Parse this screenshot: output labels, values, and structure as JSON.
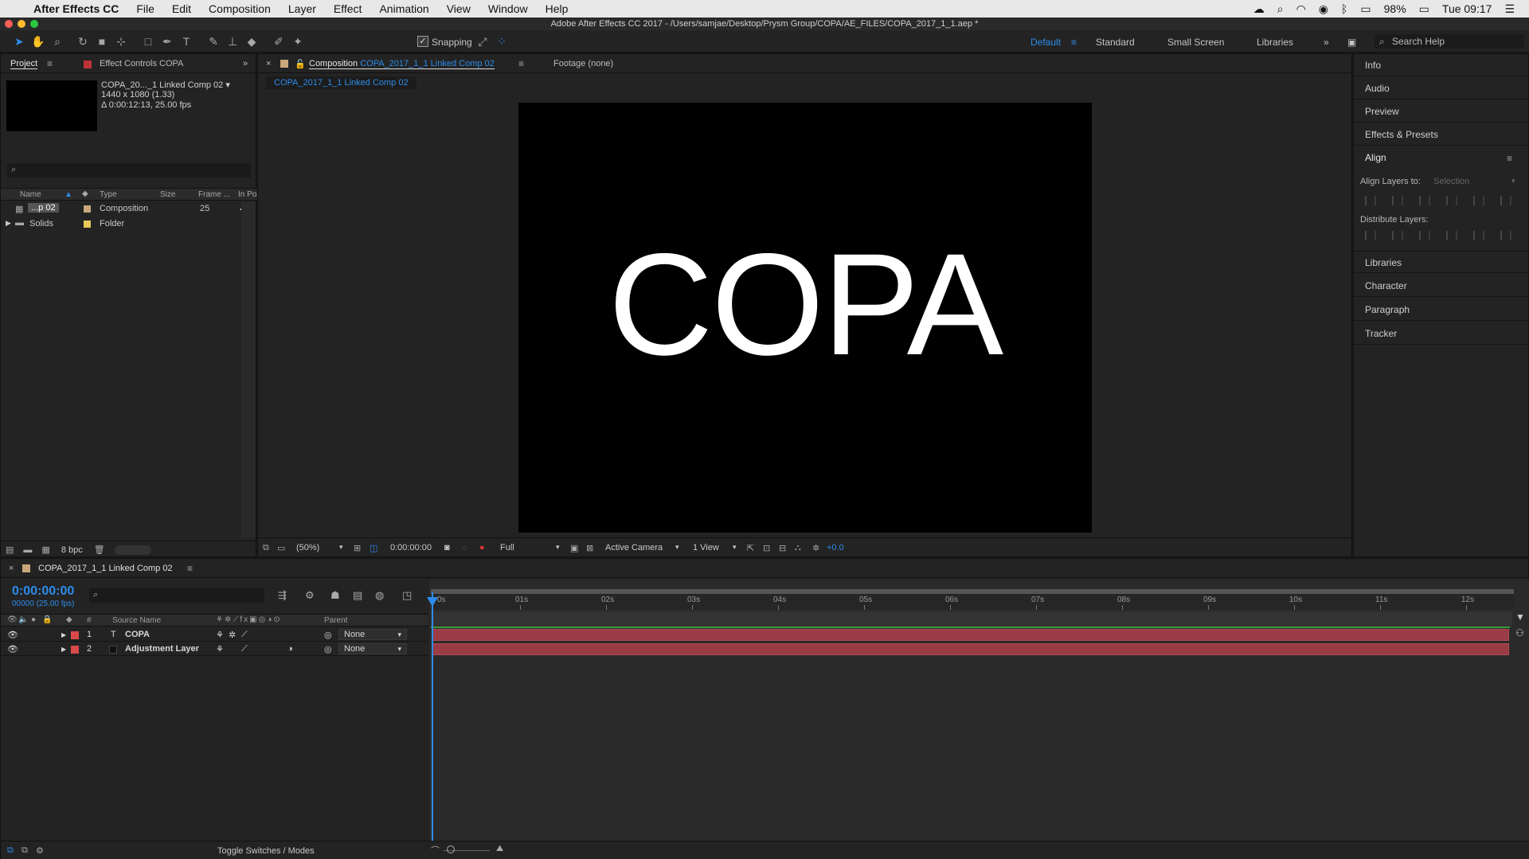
{
  "menubar": {
    "apple_glyph": "",
    "app_name": "After Effects CC",
    "items": [
      "File",
      "Edit",
      "Composition",
      "Layer",
      "Effect",
      "Animation",
      "View",
      "Window",
      "Help"
    ],
    "battery": "98%",
    "clock": "Tue 09:17"
  },
  "window": {
    "title": "Adobe After Effects CC 2017 - /Users/samjae/Desktop/Prysm Group/COPA/AE_FILES/COPA_2017_1_1.aep *"
  },
  "toolbar": {
    "snapping_label": "Snapping",
    "workspaces": [
      "Default",
      "Standard",
      "Small Screen",
      "Libraries"
    ],
    "active_workspace": "Default",
    "search_help_placeholder": "Search Help"
  },
  "project_panel": {
    "tab_project": "Project",
    "tab_effect_controls": "Effect Controls COPA",
    "selected_name": "COPA_20..._1 Linked Comp 02 ▾",
    "selected_dims": "1440 x 1080 (1.33)",
    "selected_duration": "Δ 0:00:12:13, 25.00 fps",
    "columns": [
      "Name",
      "Type",
      "Size",
      "Frame ...",
      "In Po"
    ],
    "rows": [
      {
        "name": "...p 02",
        "type": "Composition",
        "size": "",
        "frame": "25",
        "swatch": "#c8a87a"
      },
      {
        "name": "Solids",
        "type": "Folder",
        "size": "",
        "frame": "",
        "swatch": "#e8c95a"
      }
    ],
    "bpc": "8 bpc"
  },
  "comp_panel": {
    "tab_prefix": "Composition",
    "tab_name": "COPA_2017_1_1 Linked Comp 02",
    "footage_tab": "Footage (none)",
    "subtab": "COPA_2017_1_1 Linked Comp 02",
    "viewer_text": "COPA",
    "zoom": "(50%)",
    "timecode": "0:00:00:00",
    "resolution": "Full",
    "camera": "Active Camera",
    "views": "1 View",
    "exposure": "+0.0"
  },
  "right_panel": {
    "sections": [
      "Info",
      "Audio",
      "Preview",
      "Effects & Presets",
      "Align"
    ],
    "align_layers_to_label": "Align Layers to:",
    "align_layers_to_value": "Selection",
    "distribute_label": "Distribute Layers:",
    "sections_below": [
      "Libraries",
      "Character",
      "Paragraph",
      "Tracker"
    ]
  },
  "timeline": {
    "comp_tab": "COPA_2017_1_1 Linked Comp 02",
    "timecode": "0:00:00:00",
    "fps": "00000 (25.00 fps)",
    "columns": {
      "source_name": "Source Name",
      "hash": "#",
      "parent": "Parent"
    },
    "layers": [
      {
        "index": "1",
        "type_glyph": "T",
        "name": "COPA",
        "parent": "None",
        "color": "#d94a4a"
      },
      {
        "index": "2",
        "type_glyph": "",
        "name": "Adjustment Layer",
        "parent": "None",
        "color": "#d94a4a"
      }
    ],
    "ruler_ticks": [
      "0s",
      "01s",
      "02s",
      "03s",
      "04s",
      "05s",
      "06s",
      "07s",
      "08s",
      "09s",
      "10s",
      "11s",
      "12s"
    ],
    "toggle_label": "Toggle Switches / Modes"
  },
  "colors": {
    "accent": "#2d8ceb",
    "layer_bar": "#9b3b46"
  }
}
